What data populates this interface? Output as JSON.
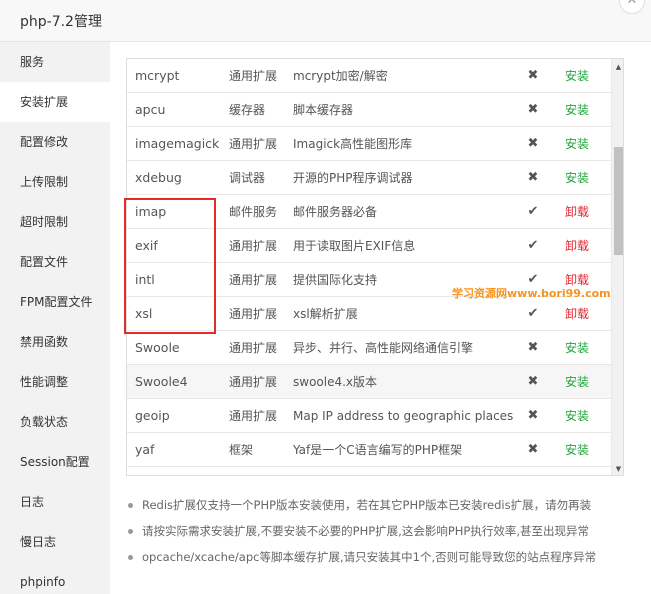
{
  "window": {
    "title": "php-7.2管理",
    "close_glyph": "✕"
  },
  "sidebar": {
    "items": [
      {
        "label": "服务"
      },
      {
        "label": "安装扩展"
      },
      {
        "label": "配置修改"
      },
      {
        "label": "上传限制"
      },
      {
        "label": "超时限制"
      },
      {
        "label": "配置文件"
      },
      {
        "label": "FPM配置文件"
      },
      {
        "label": "禁用函数"
      },
      {
        "label": "性能调整"
      },
      {
        "label": "负载状态"
      },
      {
        "label": "Session配置"
      },
      {
        "label": "日志"
      },
      {
        "label": "慢日志"
      },
      {
        "label": "phpinfo"
      }
    ],
    "active_index": 1
  },
  "extensions": {
    "rows": [
      {
        "name": "mcrypt",
        "type": "通用扩展",
        "desc": "mcrypt加密/解密",
        "status": "✖",
        "action": "安装"
      },
      {
        "name": "apcu",
        "type": "缓存器",
        "desc": "脚本缓存器",
        "status": "✖",
        "action": "安装"
      },
      {
        "name": "imagemagick",
        "type": "通用扩展",
        "desc": "Imagick高性能图形库",
        "status": "✖",
        "action": "安装"
      },
      {
        "name": "xdebug",
        "type": "调试器",
        "desc": "开源的PHP程序调试器",
        "status": "✖",
        "action": "安装"
      },
      {
        "name": "imap",
        "type": "邮件服务",
        "desc": "邮件服务器必备",
        "status": "✔",
        "action": "卸载"
      },
      {
        "name": "exif",
        "type": "通用扩展",
        "desc": "用于读取图片EXIF信息",
        "status": "✔",
        "action": "卸载"
      },
      {
        "name": "intl",
        "type": "通用扩展",
        "desc": "提供国际化支持",
        "status": "✔",
        "action": "卸载"
      },
      {
        "name": "xsl",
        "type": "通用扩展",
        "desc": "xsl解析扩展",
        "status": "✔",
        "action": "卸载"
      },
      {
        "name": "Swoole",
        "type": "通用扩展",
        "desc": "异步、并行、高性能网络通信引擎",
        "status": "✖",
        "action": "安装"
      },
      {
        "name": "Swoole4",
        "type": "通用扩展",
        "desc": "swoole4.x版本",
        "status": "✖",
        "action": "安装"
      },
      {
        "name": "geoip",
        "type": "通用扩展",
        "desc": "Map IP address to geographic places",
        "status": "✖",
        "action": "安装"
      },
      {
        "name": "yaf",
        "type": "框架",
        "desc": "Yaf是一个C语言编写的PHP框架",
        "status": "✖",
        "action": "安装"
      }
    ],
    "highlighted_row": 9
  },
  "scrollbar": {
    "up_glyph": "▲",
    "down_glyph": "▼"
  },
  "watermark": "学习资源网www.bori99.com",
  "notes": [
    "Redis扩展仅支持一个PHP版本安装使用，若在其它PHP版本已安装redis扩展，请勿再装",
    "请按实际需求安装扩展,不要安装不必要的PHP扩展,这会影响PHP执行效率,甚至出现异常",
    "opcache/xcache/apc等脚本缓存扩展,请只安装其中1个,否则可能导致您的站点程序异常"
  ],
  "colors": {
    "install": "#20a53a",
    "uninstall": "#e0262f",
    "highlight_box": "#e02c2c",
    "watermark": "#f7931e"
  }
}
